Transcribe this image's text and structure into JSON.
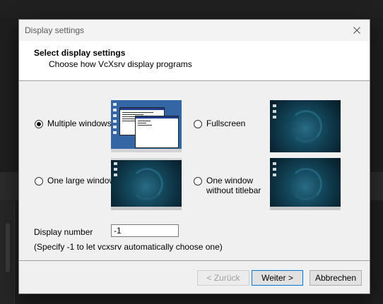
{
  "dialog": {
    "title": "Display settings",
    "header_title": "Select display settings",
    "header_subtitle": "Choose how VcXsrv display programs"
  },
  "options": [
    {
      "label": "Multiple windows",
      "checked": true
    },
    {
      "label": "Fullscreen",
      "checked": false
    },
    {
      "label": "One large window",
      "checked": false
    },
    {
      "label_line1": "One window",
      "label_line2": "without titlebar",
      "checked": false
    }
  ],
  "display_number": {
    "label": "Display number",
    "value": "-1",
    "hint": "(Specify -1 to let vcxsrv automatically choose one)"
  },
  "buttons": {
    "back": "< Zurück",
    "next": "Weiter >",
    "cancel": "Abbrechen"
  },
  "icons": {
    "close": "close-icon",
    "radio": "radio-icon"
  },
  "colors": {
    "dialog_bg": "#f0f0f0",
    "header_bg": "#ffffff",
    "accent": "#0078d7",
    "preview_blue": "#3465a4",
    "preview_teal": "#144a5f"
  }
}
